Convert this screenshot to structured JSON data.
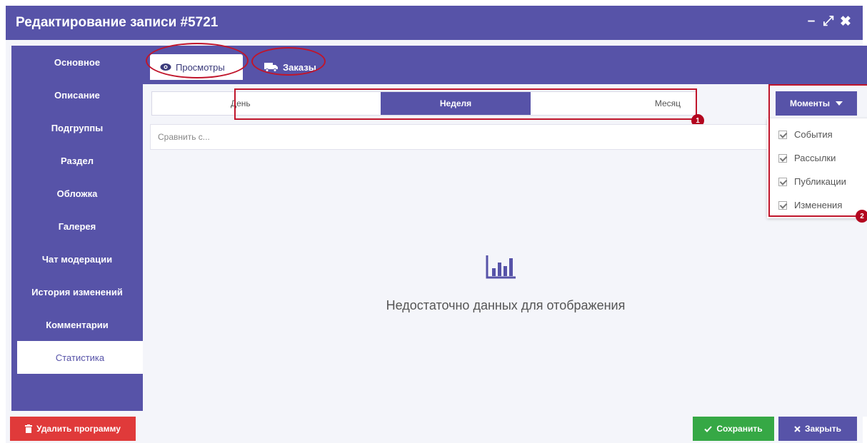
{
  "window": {
    "title": "Редактирование записи #5721",
    "controls": {
      "minimize": "–",
      "maximize": "⤢",
      "close": "✖"
    }
  },
  "sidebar": {
    "items": [
      {
        "label": "Основное"
      },
      {
        "label": "Описание"
      },
      {
        "label": "Подгруппы"
      },
      {
        "label": "Раздел"
      },
      {
        "label": "Обложка"
      },
      {
        "label": "Галерея"
      },
      {
        "label": "Чат модерации"
      },
      {
        "label": "История изменений"
      },
      {
        "label": "Комментарии"
      },
      {
        "label": "Статистика"
      }
    ],
    "active_index": 9
  },
  "tabs": {
    "views_label": "Просмотры",
    "orders_label": "Заказы"
  },
  "period": {
    "options": [
      "День",
      "Неделя",
      "Месяц"
    ],
    "selected": "Неделя",
    "annotation_badge": "1"
  },
  "compare": {
    "placeholder": "Сравнить с..."
  },
  "moments": {
    "button_label": "Моменты",
    "items": [
      {
        "label": "События",
        "checked": true
      },
      {
        "label": "Рассылки",
        "checked": true
      },
      {
        "label": "Публикации",
        "checked": true
      },
      {
        "label": "Изменения",
        "checked": true
      }
    ],
    "annotation_badge": "2"
  },
  "empty_state": {
    "message": "Недостаточно данных для отображения"
  },
  "footer": {
    "delete_label": "Удалить программу",
    "save_label": "Сохранить",
    "close_label": "Закрыть"
  },
  "colors": {
    "primary": "#5753a8",
    "annotation_red": "#c0152b",
    "delete": "#e03a3a",
    "save": "#36a845"
  }
}
